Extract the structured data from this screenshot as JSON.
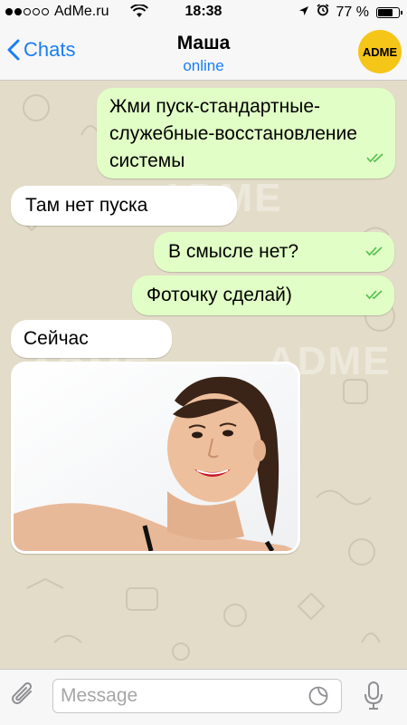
{
  "status_bar": {
    "carrier": "AdMe.ru",
    "time": "18:38",
    "battery": "77 %",
    "battery_level": 0.77
  },
  "header": {
    "back_label": "Chats",
    "contact_name": "Маша",
    "contact_status": "online",
    "avatar_text": "ADME"
  },
  "watermark": "ADME",
  "messages": [
    {
      "direction": "out",
      "text": "Жми пуск-стандартные-служебные-восстановление системы",
      "read": true
    },
    {
      "direction": "in",
      "text": "Там нет пуска"
    },
    {
      "direction": "out",
      "text": "В смысле нет?",
      "read": true
    },
    {
      "direction": "out",
      "text": "Фоточку сделай)",
      "read": true
    },
    {
      "direction": "in",
      "text": "Сейчас"
    },
    {
      "direction": "in",
      "type": "photo"
    }
  ],
  "input": {
    "placeholder": "Message"
  },
  "colors": {
    "accent": "#1a7ef5",
    "outgoing_bubble": "#e1fec6",
    "incoming_bubble": "#ffffff",
    "chat_background": "#e3dcc8",
    "read_check": "#4fbf4a",
    "avatar": "#f5c518"
  },
  "icons": [
    "wifi-icon",
    "location-arrow-icon",
    "alarm-icon",
    "battery-icon",
    "back-chevron-icon",
    "paperclip-icon",
    "sticker-icon",
    "microphone-icon",
    "double-check-icon"
  ]
}
